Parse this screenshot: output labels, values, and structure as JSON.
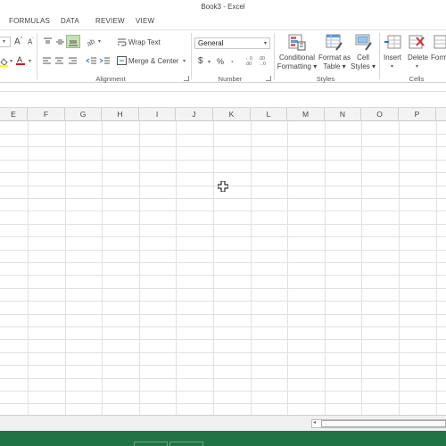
{
  "window": {
    "title": "Book3 - Excel"
  },
  "tabs": [
    "FORMULAS",
    "DATA",
    "REVIEW",
    "VIEW"
  ],
  "ribbon": {
    "alignment": {
      "label": "Alignment",
      "wrap_text": "Wrap Text",
      "merge_center": "Merge & Center"
    },
    "number": {
      "label": "Number",
      "format_value": "General",
      "currency": "$",
      "percent": "%",
      "comma": "‚"
    },
    "styles": {
      "label": "Styles",
      "conditional_formatting": [
        "Conditional",
        "Formatting ▾"
      ],
      "format_as_table": [
        "Format as",
        "Table ▾"
      ],
      "cell_styles": [
        "Cell",
        "Styles ▾"
      ]
    },
    "cells": {
      "label": "Cells",
      "insert": "Insert",
      "delete": "Delete",
      "format": "Form"
    }
  },
  "columns": [
    "E",
    "F",
    "G",
    "H",
    "I",
    "J",
    "K",
    "L",
    "M",
    "N",
    "O",
    "P"
  ],
  "colors": {
    "accent_green": "#217346",
    "grid_line": "#e1e1e1",
    "header_bg": "#f3f3f3"
  }
}
